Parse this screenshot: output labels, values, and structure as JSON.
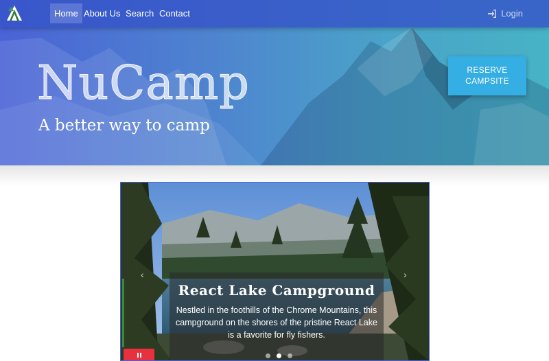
{
  "nav": {
    "brand_icon": "tent-logo-icon",
    "items": [
      {
        "label": "Home",
        "active": true
      },
      {
        "label": "About Us",
        "active": false
      },
      {
        "label": "Search",
        "active": false
      },
      {
        "label": "Contact",
        "active": false
      }
    ],
    "login_label": "Login",
    "login_icon": "sign-in-icon"
  },
  "hero": {
    "title": "NuCamp",
    "subtitle": "A better way to camp",
    "reserve_label": "RESERVE CAMPSITE"
  },
  "carousel": {
    "caption_title": "React Lake Campground",
    "caption_text": "Nestled in the foothills of the Chrome Mountains, this campground on the shores of the pristine React Lake is a favorite for fly fishers.",
    "indicator_count": 3,
    "active_indicator": 1,
    "prev_icon": "chevron-left-icon",
    "next_icon": "chevron-right-icon",
    "pause_icon": "pause-icon"
  },
  "colors": {
    "navbar": "#3654c8",
    "reserve_button": "#35aee3",
    "pause_button": "#e7323d",
    "carousel_border": "#4a62d8"
  }
}
